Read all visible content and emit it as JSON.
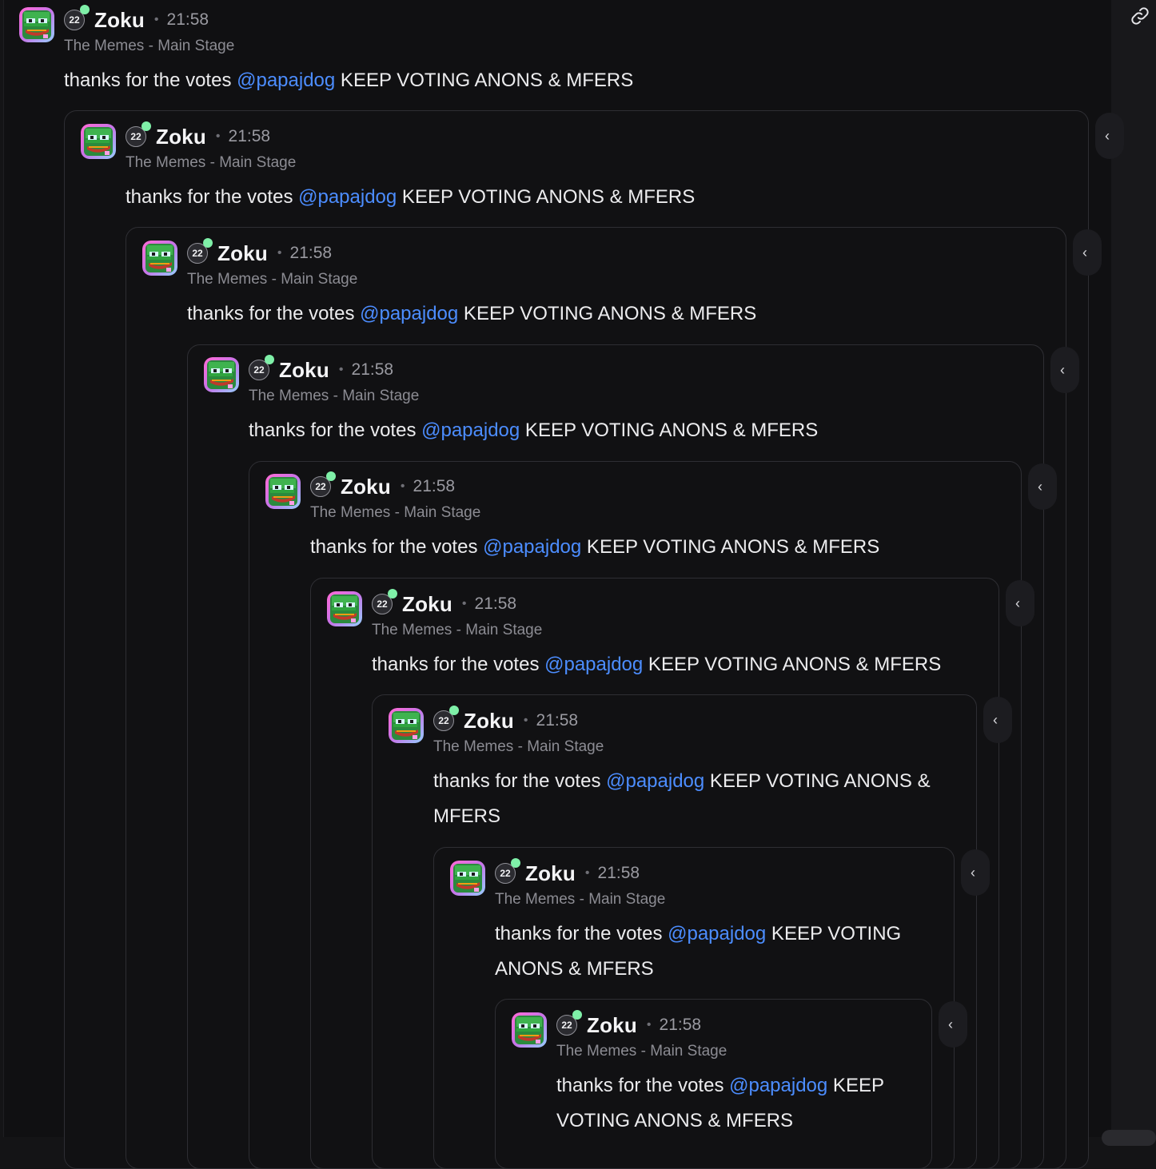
{
  "thread": {
    "messages": [
      {
        "author": "Zoku",
        "level": "22",
        "separator": "•",
        "time": "21:58",
        "channel": "The Memes - Main Stage",
        "text_before": "thanks for the votes ",
        "mention": "@papajdog",
        "text_after": " KEEP VOTING ANONS & MFERS"
      },
      {
        "author": "Zoku",
        "level": "22",
        "separator": "•",
        "time": "21:58",
        "channel": "The Memes - Main Stage",
        "text_before": "thanks for the votes ",
        "mention": "@papajdog",
        "text_after": " KEEP VOTING ANONS & MFERS"
      },
      {
        "author": "Zoku",
        "level": "22",
        "separator": "•",
        "time": "21:58",
        "channel": "The Memes - Main Stage",
        "text_before": "thanks for the votes ",
        "mention": "@papajdog",
        "text_after": " KEEP VOTING ANONS & MFERS"
      },
      {
        "author": "Zoku",
        "level": "22",
        "separator": "•",
        "time": "21:58",
        "channel": "The Memes - Main Stage",
        "text_before": "thanks for the votes ",
        "mention": "@papajdog",
        "text_after": " KEEP VOTING ANONS & MFERS"
      },
      {
        "author": "Zoku",
        "level": "22",
        "separator": "•",
        "time": "21:58",
        "channel": "The Memes - Main Stage",
        "text_before": "thanks for the votes ",
        "mention": "@papajdog",
        "text_after": " KEEP VOTING ANONS & MFERS"
      },
      {
        "author": "Zoku",
        "level": "22",
        "separator": "•",
        "time": "21:58",
        "channel": "The Memes - Main Stage",
        "text_before": "thanks for the votes ",
        "mention": "@papajdog",
        "text_after": " KEEP VOTING ANONS & MFERS"
      },
      {
        "author": "Zoku",
        "level": "22",
        "separator": "•",
        "time": "21:58",
        "channel": "The Memes - Main Stage",
        "text_before": "thanks for the votes ",
        "mention": "@papajdog",
        "text_after": " KEEP VOTING ANONS & MFERS"
      },
      {
        "author": "Zoku",
        "level": "22",
        "separator": "•",
        "time": "21:58",
        "channel": "The Memes - Main Stage",
        "text_before": "thanks for the votes ",
        "mention": "@papajdog",
        "text_after": " KEEP VOTING ANONS & MFERS"
      },
      {
        "author": "Zoku",
        "level": "22",
        "separator": "•",
        "time": "21:58",
        "channel": "The Memes - Main Stage",
        "text_before": "thanks for the votes ",
        "mention": "@papajdog",
        "text_after": " KEEP VOTING ANONS & MFERS"
      }
    ]
  },
  "icons": {
    "copy_link": "link-icon",
    "side_tab": "chevron-left-icon",
    "avatar": "pepe-avatar"
  },
  "colors": {
    "mention": "#4c8dff",
    "online": "#7ff0a8",
    "background": "#101012"
  }
}
